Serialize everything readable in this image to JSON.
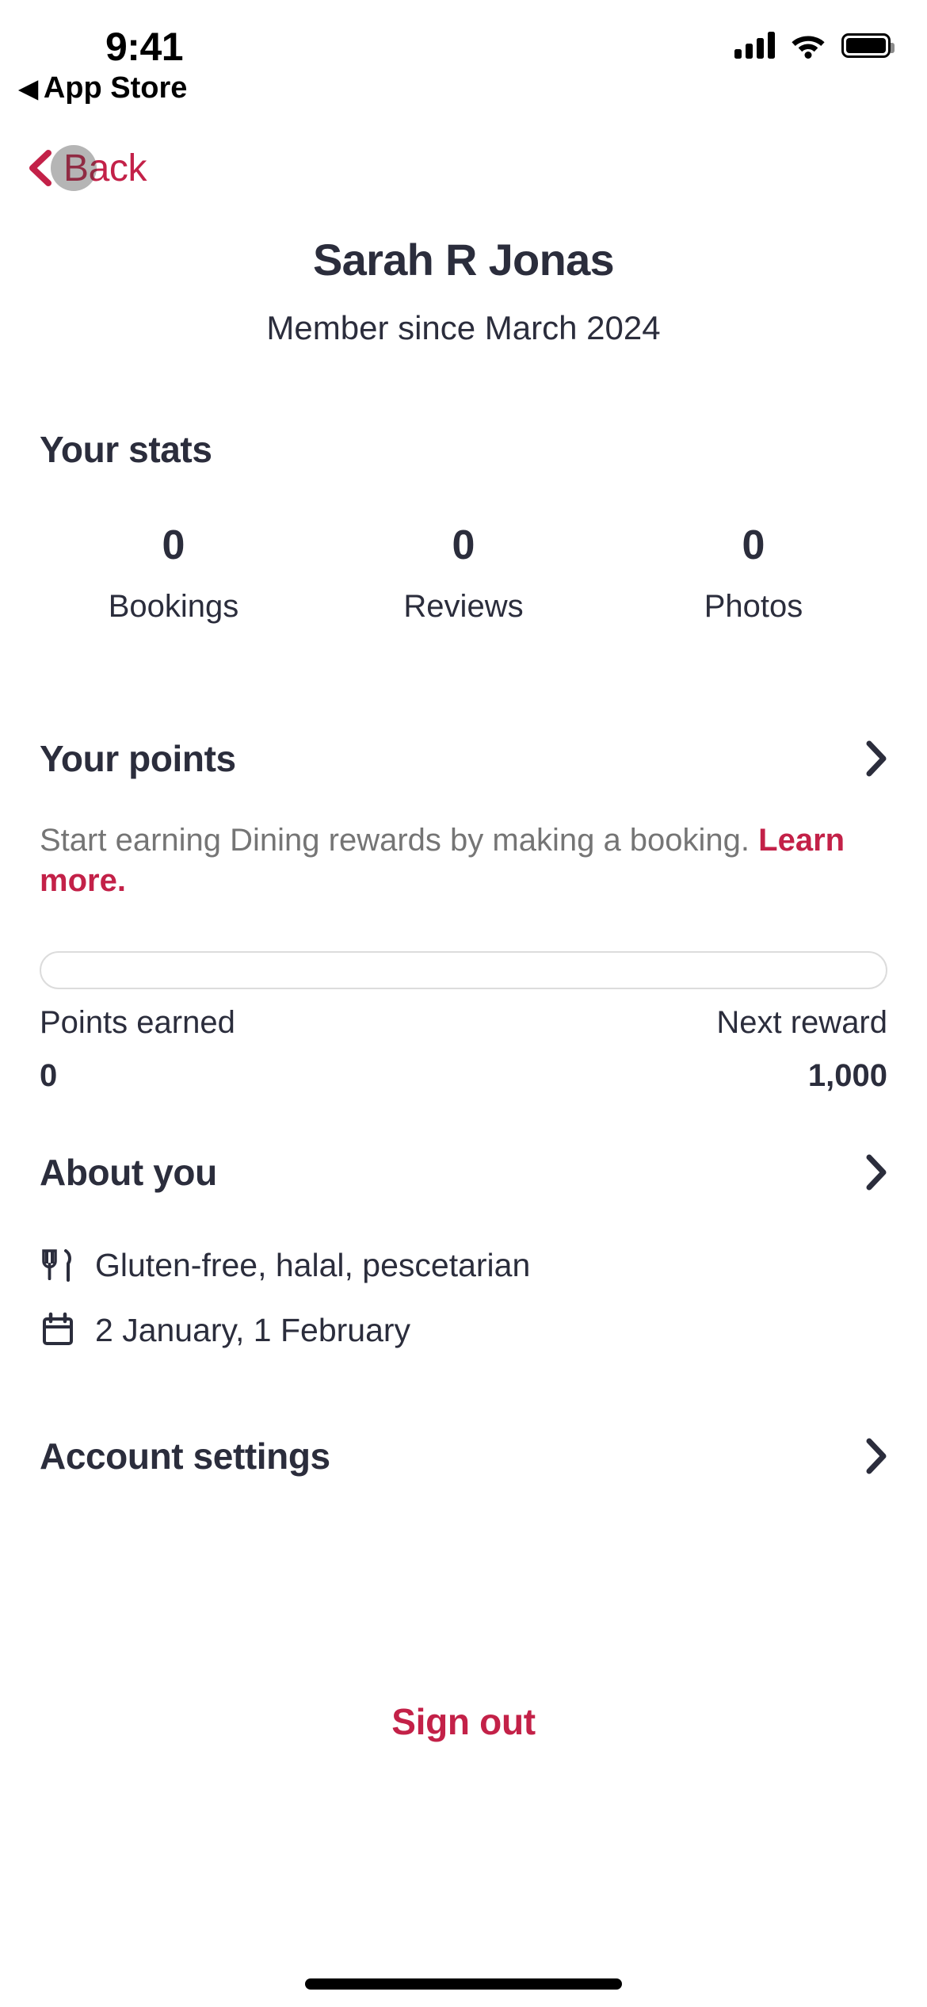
{
  "status_bar": {
    "time": "9:41",
    "return_app_label": "App Store",
    "return_triangle": "◀",
    "icons": [
      "cellular-signal-icon",
      "wifi-icon",
      "battery-icon"
    ]
  },
  "nav": {
    "back_label": "Back",
    "back_icon": "chevron-left-icon"
  },
  "header": {
    "name": "Sarah R Jonas",
    "member_since": "Member since March 2024"
  },
  "stats": {
    "title": "Your stats",
    "items": [
      {
        "value": "0",
        "label": "Bookings"
      },
      {
        "value": "0",
        "label": "Reviews"
      },
      {
        "value": "0",
        "label": "Photos"
      }
    ]
  },
  "points": {
    "title": "Your points",
    "description": "Start earning Dining rewards by making a booking. ",
    "learn_more": "Learn more.",
    "progress_percent": "0",
    "earned_label": "Points earned",
    "earned_value": "0",
    "next_reward_label": "Next reward",
    "next_reward_value": "1,000"
  },
  "about": {
    "title": "About you",
    "items": [
      {
        "icon": "cutlery-icon",
        "text": "Gluten-free, halal, pescetarian"
      },
      {
        "icon": "calendar-icon",
        "text": "2 January, 1 February"
      }
    ]
  },
  "account": {
    "title": "Account settings"
  },
  "sign_out": {
    "label": "Sign out"
  },
  "colors": {
    "accent": "#c32148",
    "text_primary": "#2b2d3c",
    "text_muted": "#757575",
    "border": "#dcdcdc",
    "background": "#ffffff"
  }
}
